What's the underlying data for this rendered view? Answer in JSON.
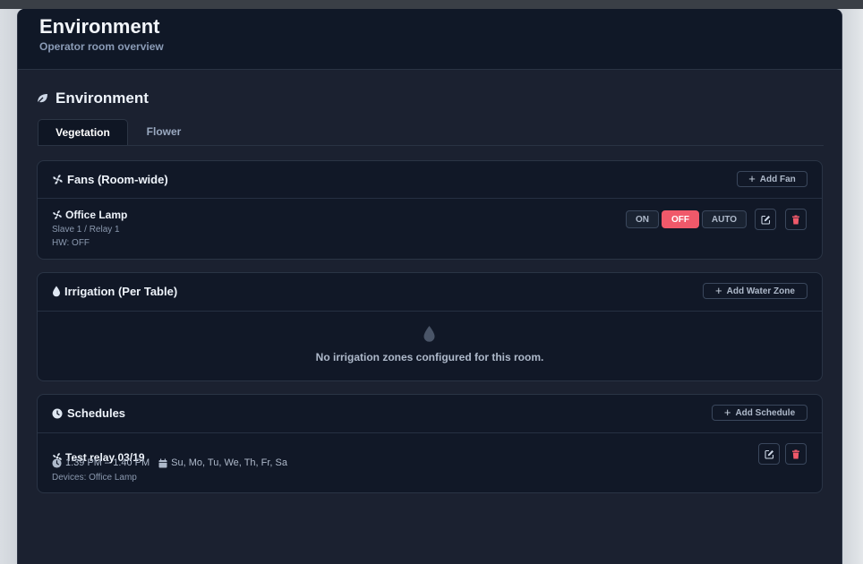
{
  "header": {
    "title": "Environment",
    "subtitle": "Operator room overview"
  },
  "section": {
    "title": "Environment",
    "icon": "leaf-icon"
  },
  "tabs": [
    {
      "label": "Vegetation",
      "active": true
    },
    {
      "label": "Flower",
      "active": false
    }
  ],
  "fans": {
    "title": "Fans (Room-wide)",
    "add_label": "Add Fan",
    "items": [
      {
        "name": "Office Lamp",
        "location": "Slave 1 / Relay 1",
        "hw_status": "HW: OFF",
        "modes": {
          "on": "ON",
          "off": "OFF",
          "auto": "AUTO"
        },
        "selected_mode": "OFF"
      }
    ]
  },
  "irrigation": {
    "title": "Irrigation (Per Table)",
    "add_label": "Add Water Zone",
    "empty_text": "No irrigation zones configured for this room."
  },
  "schedules": {
    "title": "Schedules",
    "add_label": "Add Schedule",
    "items": [
      {
        "name": "Test relay 03/19",
        "time": "1:39 PM – 1:40 PM",
        "days": "Su, Mo, Tu, We, Th, Fr, Sa",
        "devices": "Devices: Office Lamp"
      }
    ]
  },
  "colors": {
    "accent_off": "#f0596a",
    "delete": "#f0596a",
    "background": "#1b2130",
    "card": "#111827"
  }
}
